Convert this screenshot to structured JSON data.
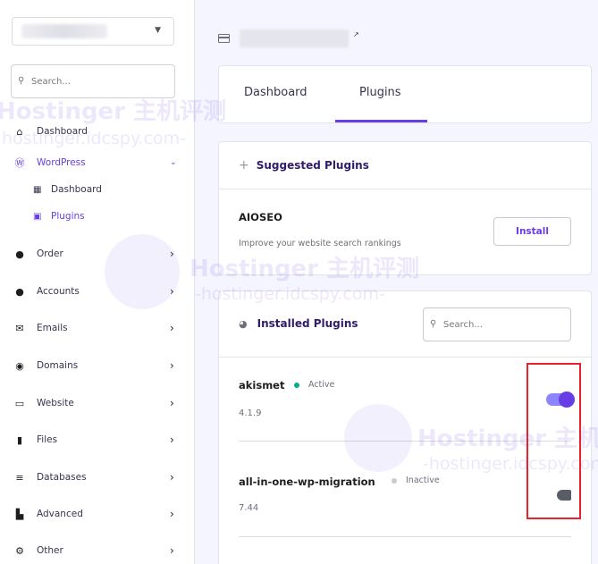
{
  "sidebar": {
    "search_placeholder": "Search...",
    "items": [
      {
        "label": "Dashboard",
        "icon": "home-icon"
      },
      {
        "label": "WordPress",
        "icon": "wordpress-icon"
      },
      {
        "label": "Order",
        "icon": "info-icon"
      },
      {
        "label": "Accounts",
        "icon": "info-icon"
      },
      {
        "label": "Emails",
        "icon": "mail-icon"
      },
      {
        "label": "Domains",
        "icon": "globe-icon"
      },
      {
        "label": "Website",
        "icon": "monitor-icon"
      },
      {
        "label": "Files",
        "icon": "file-icon"
      },
      {
        "label": "Databases",
        "icon": "database-icon"
      },
      {
        "label": "Advanced",
        "icon": "cabinet-icon"
      },
      {
        "label": "Other",
        "icon": "gears-icon"
      }
    ],
    "wordpress_sub": [
      {
        "label": "Dashboard",
        "icon": "grid-icon"
      },
      {
        "label": "Plugins",
        "icon": "plugin-icon"
      }
    ]
  },
  "tabs": [
    "Dashboard",
    "Plugins"
  ],
  "active_tab": "Plugins",
  "suggested": {
    "title": "Suggested Plugins",
    "plugin_name": "AIOSEO",
    "plugin_desc": "Improve your website search rankings",
    "install_label": "Install"
  },
  "installed": {
    "title": "Installed Plugins",
    "search_placeholder": "Search...",
    "plugins": [
      {
        "name": "akismet",
        "status": "Active",
        "version": "4.1.9",
        "enabled": true
      },
      {
        "name": "all-in-one-wp-migration",
        "status": "Inactive",
        "version": "7.44",
        "enabled": false
      }
    ]
  },
  "watermark": {
    "brand": "Hostinger 主机评测",
    "url": "-hostinger.idcspy.com-",
    "url_short": "hostinger.idcspy.com-"
  },
  "colors": {
    "accent": "#673de6",
    "active_dot": "#00b090",
    "inactive_dot": "#c9c9d1",
    "highlight": "#ec2129"
  }
}
